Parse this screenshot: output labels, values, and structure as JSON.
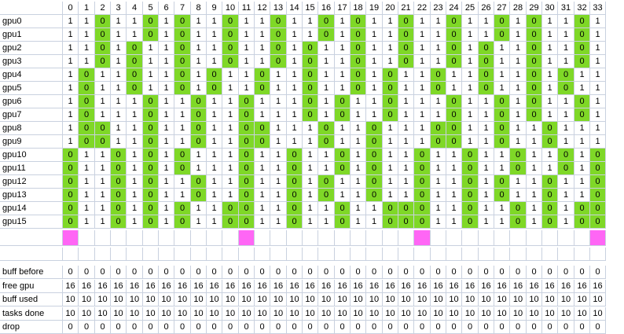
{
  "colors": {
    "highlight": "#7fd827",
    "marker": "#ff66f5",
    "grid_line": "#c9d1df"
  },
  "columns": [
    "0",
    "1",
    "2",
    "3",
    "4",
    "5",
    "6",
    "7",
    "8",
    "9",
    "10",
    "11",
    "12",
    "13",
    "14",
    "15",
    "16",
    "17",
    "18",
    "19",
    "20",
    "21",
    "22",
    "23",
    "24",
    "25",
    "26",
    "27",
    "28",
    "29",
    "30",
    "31",
    "32",
    "33"
  ],
  "gpu_rows": [
    {
      "label": "gpu0",
      "values": [
        1,
        1,
        0,
        1,
        1,
        0,
        1,
        0,
        1,
        1,
        0,
        1,
        1,
        0,
        1,
        1,
        0,
        1,
        0,
        1,
        1,
        0,
        1,
        1,
        0,
        1,
        1,
        0,
        1,
        0,
        1,
        1,
        0,
        1
      ]
    },
    {
      "label": "gpu1",
      "values": [
        1,
        1,
        0,
        1,
        1,
        0,
        1,
        0,
        1,
        1,
        0,
        1,
        1,
        0,
        1,
        1,
        0,
        1,
        0,
        1,
        1,
        0,
        1,
        1,
        0,
        1,
        1,
        0,
        1,
        0,
        1,
        1,
        0,
        1
      ]
    },
    {
      "label": "gpu2",
      "values": [
        1,
        1,
        0,
        1,
        0,
        1,
        1,
        0,
        1,
        1,
        0,
        1,
        1,
        0,
        1,
        0,
        1,
        1,
        0,
        1,
        1,
        0,
        1,
        1,
        0,
        1,
        0,
        1,
        1,
        0,
        1,
        1,
        0,
        1
      ]
    },
    {
      "label": "gpu3",
      "values": [
        1,
        1,
        0,
        1,
        0,
        1,
        1,
        0,
        1,
        1,
        0,
        1,
        1,
        0,
        1,
        0,
        1,
        1,
        0,
        1,
        1,
        0,
        1,
        1,
        0,
        1,
        0,
        1,
        1,
        0,
        1,
        1,
        0,
        1
      ]
    },
    {
      "label": "gpu4",
      "values": [
        1,
        0,
        1,
        1,
        0,
        1,
        1,
        0,
        1,
        0,
        1,
        1,
        0,
        1,
        1,
        0,
        1,
        1,
        0,
        1,
        0,
        1,
        1,
        0,
        1,
        1,
        0,
        1,
        1,
        0,
        1,
        0,
        1,
        1
      ]
    },
    {
      "label": "gpu5",
      "values": [
        1,
        0,
        1,
        1,
        0,
        1,
        1,
        0,
        1,
        0,
        1,
        1,
        0,
        1,
        1,
        0,
        1,
        1,
        0,
        1,
        0,
        1,
        1,
        0,
        1,
        1,
        0,
        1,
        1,
        0,
        1,
        0,
        1,
        1
      ]
    },
    {
      "label": "gpu6",
      "values": [
        1,
        0,
        1,
        1,
        1,
        0,
        1,
        1,
        0,
        1,
        1,
        0,
        1,
        1,
        1,
        0,
        1,
        0,
        1,
        1,
        0,
        1,
        1,
        1,
        0,
        1,
        1,
        0,
        1,
        0,
        1,
        1,
        0,
        1
      ]
    },
    {
      "label": "gpu7",
      "values": [
        1,
        0,
        1,
        1,
        1,
        0,
        1,
        1,
        0,
        1,
        1,
        0,
        1,
        1,
        1,
        0,
        1,
        0,
        1,
        1,
        0,
        1,
        1,
        1,
        0,
        1,
        1,
        0,
        1,
        0,
        1,
        1,
        0,
        1
      ]
    },
    {
      "label": "gpu8",
      "values": [
        1,
        0,
        0,
        1,
        1,
        0,
        1,
        1,
        0,
        1,
        1,
        0,
        0,
        1,
        1,
        1,
        0,
        1,
        1,
        0,
        1,
        1,
        1,
        0,
        0,
        1,
        1,
        0,
        1,
        1,
        0,
        1,
        1,
        1
      ]
    },
    {
      "label": "gpu9",
      "values": [
        1,
        0,
        0,
        1,
        1,
        0,
        1,
        1,
        0,
        1,
        1,
        0,
        0,
        1,
        1,
        1,
        0,
        1,
        1,
        0,
        1,
        1,
        1,
        0,
        0,
        1,
        1,
        0,
        1,
        1,
        0,
        1,
        1,
        1
      ]
    },
    {
      "label": "gpu10",
      "values": [
        0,
        1,
        1,
        0,
        1,
        0,
        1,
        0,
        1,
        1,
        1,
        0,
        1,
        1,
        0,
        1,
        1,
        0,
        1,
        0,
        1,
        1,
        0,
        1,
        1,
        0,
        1,
        1,
        0,
        1,
        1,
        0,
        1,
        0
      ]
    },
    {
      "label": "gpu11",
      "values": [
        0,
        1,
        1,
        0,
        1,
        0,
        1,
        0,
        1,
        1,
        1,
        0,
        1,
        1,
        0,
        1,
        1,
        0,
        1,
        0,
        1,
        1,
        0,
        1,
        1,
        0,
        1,
        1,
        0,
        1,
        1,
        0,
        1,
        0
      ]
    },
    {
      "label": "gpu12",
      "values": [
        0,
        1,
        1,
        0,
        1,
        0,
        1,
        1,
        0,
        1,
        1,
        0,
        1,
        1,
        0,
        1,
        0,
        1,
        1,
        0,
        1,
        1,
        0,
        1,
        1,
        0,
        1,
        0,
        1,
        1,
        0,
        1,
        1,
        0
      ]
    },
    {
      "label": "gpu13",
      "values": [
        0,
        1,
        1,
        0,
        1,
        0,
        1,
        1,
        0,
        1,
        1,
        0,
        1,
        1,
        0,
        1,
        0,
        1,
        1,
        0,
        1,
        1,
        0,
        1,
        1,
        0,
        1,
        0,
        1,
        1,
        0,
        1,
        1,
        0
      ]
    },
    {
      "label": "gpu14",
      "values": [
        0,
        1,
        1,
        0,
        1,
        0,
        1,
        0,
        1,
        1,
        0,
        0,
        1,
        1,
        0,
        1,
        1,
        0,
        1,
        1,
        0,
        0,
        0,
        1,
        1,
        0,
        1,
        1,
        0,
        1,
        0,
        1,
        0,
        0
      ]
    },
    {
      "label": "gpu15",
      "values": [
        0,
        1,
        1,
        0,
        1,
        0,
        1,
        0,
        1,
        1,
        0,
        0,
        1,
        1,
        0,
        1,
        1,
        0,
        1,
        1,
        0,
        0,
        0,
        1,
        1,
        0,
        1,
        1,
        0,
        1,
        0,
        1,
        0,
        0
      ]
    }
  ],
  "marker_columns": [
    0,
    11,
    22,
    33
  ],
  "stat_rows": [
    {
      "label": "buff before",
      "values": [
        "0",
        "0",
        "0",
        "0",
        "0",
        "0",
        "0",
        "0",
        "0",
        "0",
        "0",
        "0",
        "0",
        "0",
        "0",
        "0",
        "0",
        "0",
        "0",
        "0",
        "0",
        "0",
        "0",
        "0",
        "0",
        "0",
        "0",
        "0",
        "0",
        "0",
        "0",
        "0",
        "0",
        "0"
      ]
    },
    {
      "label": "free gpu",
      "values": [
        "16",
        "16",
        "16",
        "16",
        "16",
        "16",
        "16",
        "16",
        "16",
        "16",
        "16",
        "16",
        "16",
        "16",
        "16",
        "16",
        "16",
        "16",
        "16",
        "16",
        "16",
        "16",
        "16",
        "16",
        "16",
        "16",
        "16",
        "16",
        "16",
        "16",
        "16",
        "16",
        "16",
        "16"
      ]
    },
    {
      "label": "buff used",
      "values": [
        "10",
        "10",
        "10",
        "10",
        "10",
        "10",
        "10",
        "10",
        "10",
        "10",
        "10",
        "10",
        "10",
        "10",
        "10",
        "10",
        "10",
        "10",
        "10",
        "10",
        "10",
        "10",
        "10",
        "10",
        "10",
        "10",
        "10",
        "10",
        "10",
        "10",
        "10",
        "10",
        "10",
        "10"
      ]
    },
    {
      "label": "tasks done",
      "values": [
        "10",
        "10",
        "10",
        "10",
        "10",
        "10",
        "10",
        "10",
        "10",
        "10",
        "10",
        "10",
        "10",
        "10",
        "10",
        "10",
        "10",
        "10",
        "10",
        "10",
        "10",
        "10",
        "10",
        "10",
        "10",
        "10",
        "10",
        "10",
        "10",
        "10",
        "10",
        "10",
        "10",
        "10"
      ]
    },
    {
      "label": "drop",
      "values": [
        "0",
        "0",
        "0",
        "0",
        "0",
        "0",
        "0",
        "0",
        "0",
        "0",
        "0",
        "0",
        "0",
        "0",
        "0",
        "0",
        "0",
        "0",
        "0",
        "0",
        "0",
        "0",
        "0",
        "0",
        "0",
        "0",
        "0",
        "0",
        "0",
        "0",
        "0",
        "0",
        "0",
        "0"
      ]
    }
  ]
}
